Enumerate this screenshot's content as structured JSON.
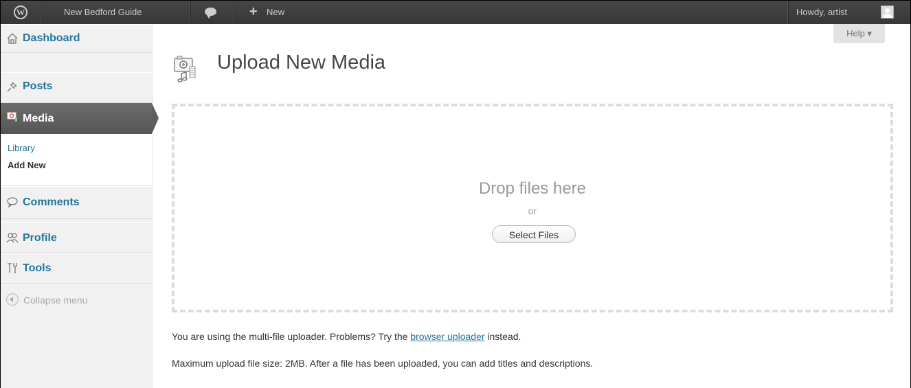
{
  "adminbar": {
    "site_name": "New Bedford Guide",
    "new_label": "New",
    "howdy": "Howdy, artist"
  },
  "sidebar": {
    "items": [
      {
        "label": "Dashboard",
        "icon": "home-icon"
      },
      {
        "label": "Posts",
        "icon": "pushpin-icon"
      },
      {
        "label": "Media",
        "icon": "media-icon"
      },
      {
        "label": "Comments",
        "icon": "comment-bubble-icon"
      },
      {
        "label": "Profile",
        "icon": "users-icon"
      },
      {
        "label": "Tools",
        "icon": "tools-icon"
      }
    ],
    "media_submenu": [
      "Library",
      "Add New"
    ],
    "collapse_label": "Collapse menu"
  },
  "help_label": "Help ▾",
  "page_title": "Upload New Media",
  "dropzone": {
    "drop_text": "Drop files here",
    "or_text": "or",
    "select_label": "Select Files"
  },
  "info": {
    "line1_prefix": "You are using the multi-file uploader. Problems? Try the",
    "line1_link": "browser uploader",
    "line1_suffix": "instead.",
    "line2": "Maximum upload file size: 2MB. After a file has been uploaded, you can add titles and descriptions."
  },
  "colors": {
    "adminbar": "#464646",
    "link": "#21759b",
    "active_menu": "#606060"
  }
}
